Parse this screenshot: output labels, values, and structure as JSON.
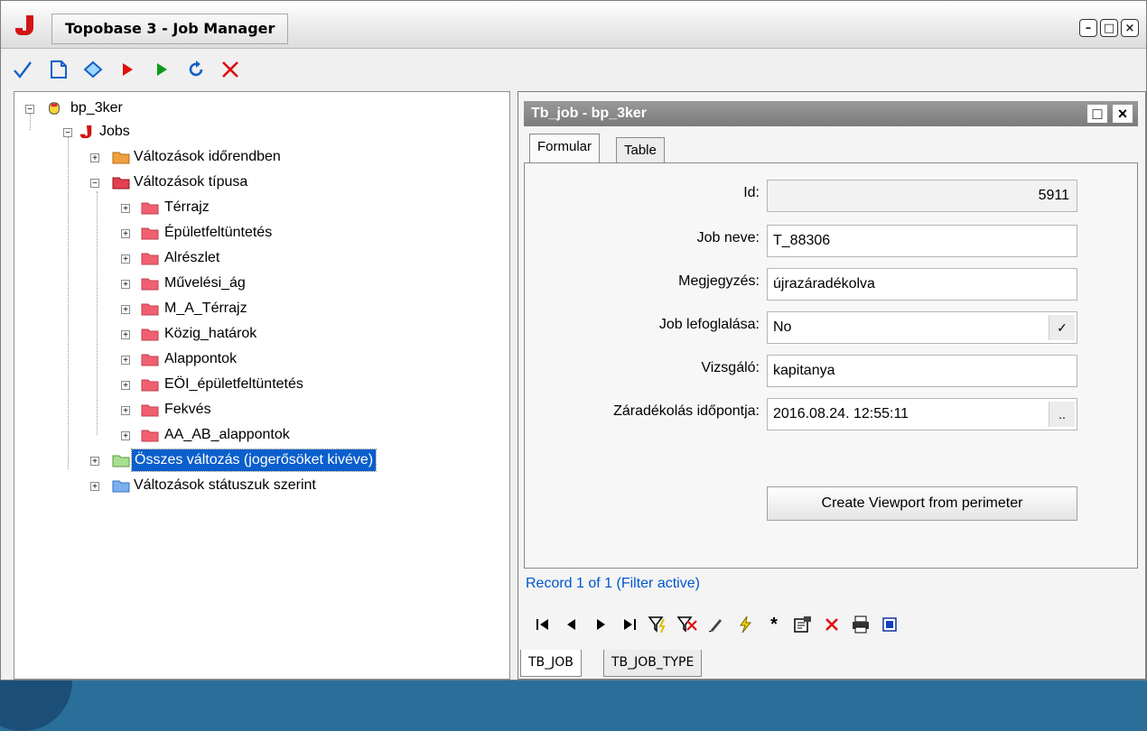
{
  "window": {
    "title": "Topobase 3 - Job Manager",
    "controls": [
      "minimize",
      "maximize",
      "close"
    ]
  },
  "toolbar": {
    "icons": [
      "check-icon",
      "new-document-icon",
      "diamond-icon",
      "play-red-icon",
      "play-green-icon",
      "refresh-icon",
      "delete-icon"
    ]
  },
  "tree": {
    "root": "bp_3ker",
    "jobs": "Jobs",
    "nodes": [
      {
        "label": "Változások időrendben",
        "color": "#f0a040"
      },
      {
        "label": "Változások típusa",
        "color": "#e04050"
      },
      {
        "label": "Térrajz",
        "color": "#f06070"
      },
      {
        "label": "Épületfeltüntetés",
        "color": "#f06070"
      },
      {
        "label": "Alrészlet",
        "color": "#f06070"
      },
      {
        "label": "Művelési_ág",
        "color": "#f06070"
      },
      {
        "label": "M_A_Térrajz",
        "color": "#f06070"
      },
      {
        "label": "Közig_határok",
        "color": "#f06070"
      },
      {
        "label": "Alappontok",
        "color": "#f06070"
      },
      {
        "label": "EÖI_épületfeltüntetés",
        "color": "#f06070"
      },
      {
        "label": "Fekvés",
        "color": "#f06070"
      },
      {
        "label": "AA_AB_alappontok",
        "color": "#f06070"
      },
      {
        "label": "Összes változás (jogerősöket kivéve)",
        "color": "#a8e090"
      },
      {
        "label": "Változások státuszuk szerint",
        "color": "#7ab0f0"
      }
    ]
  },
  "panel": {
    "title": "Tb_job - bp_3ker",
    "tabs": [
      "Formular",
      "Table"
    ],
    "form": {
      "id_label": "Id:",
      "id_value": "5911",
      "name_label": "Job neve:",
      "name_value": "T_88306",
      "note_label": "Megjegyzés:",
      "note_value": "újrazáradékolva",
      "lock_label": "Job lefoglalása:",
      "lock_value": "No",
      "lock_btn": "✓",
      "inspector_label": "Vizsgáló:",
      "inspector_value": "kapitanya",
      "date_label": "Záradékolás időpontja:",
      "date_value": "2016.08.24. 12:55:11",
      "date_btn": "..",
      "viewport_button": "Create Viewport from perimeter"
    },
    "status": "Record 1 of 1 (Filter active)",
    "bottom_tabs": [
      "TB_JOB",
      "TB_JOB_TYPE"
    ]
  }
}
